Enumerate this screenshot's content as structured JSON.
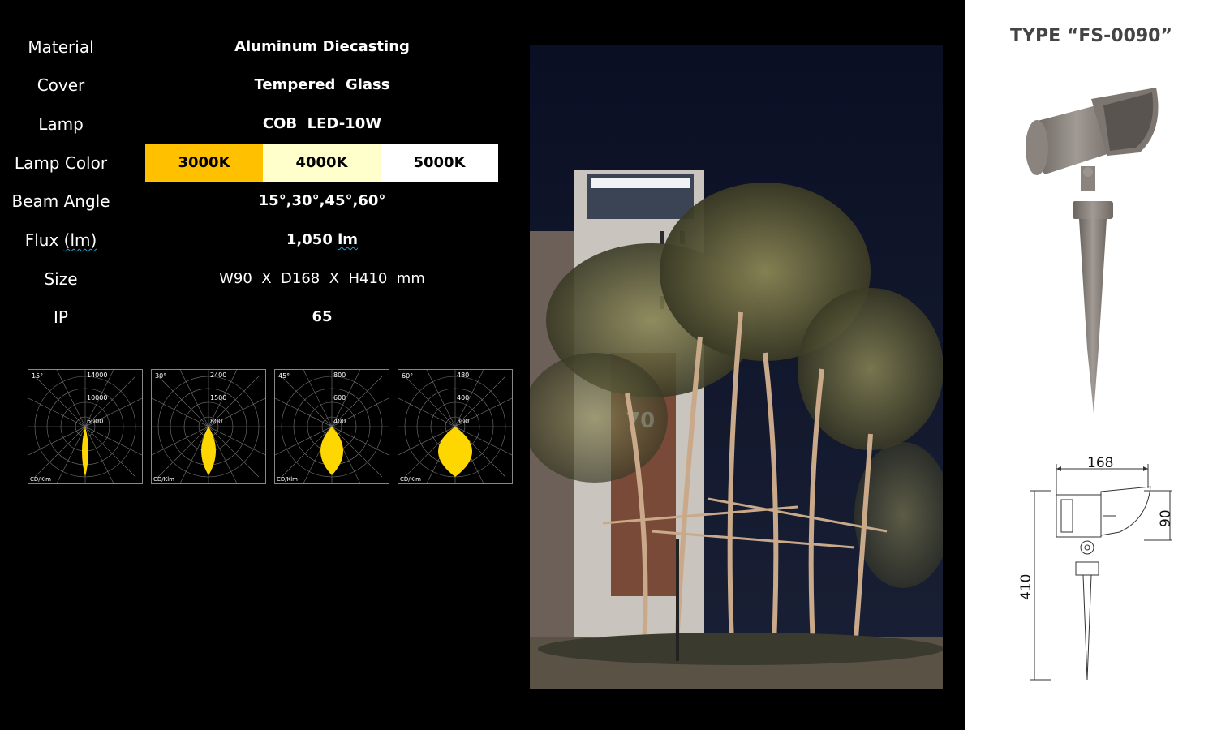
{
  "specs": [
    {
      "label": "Material",
      "value": "Aluminum Diecasting"
    },
    {
      "label": "Cover",
      "value": "Tempered  Glass"
    },
    {
      "label": "Lamp",
      "value": "COB  LED-10W"
    },
    {
      "label": "Lamp Color"
    },
    {
      "label": "Beam Angle",
      "value": "15°,30°,45°,60°"
    },
    {
      "label": "Flux",
      "label_unit": "(lm)",
      "value": "1,050",
      "value_unit": "lm"
    },
    {
      "label": "Size",
      "value": "W90  X  D168  X  H410  mm"
    },
    {
      "label": "IP",
      "value": "65"
    }
  ],
  "lamp_colors": [
    {
      "label": "3000K",
      "color": "#FFC000"
    },
    {
      "label": "4000K",
      "color": "#FFFFCC"
    },
    {
      "label": "5000K",
      "color": "#FFFFFF"
    }
  ],
  "polar_charts": [
    {
      "angle": "15°",
      "ticks": [
        "14000",
        "10000",
        "6000"
      ],
      "unit": "CD/Klm"
    },
    {
      "angle": "30°",
      "ticks": [
        "2400",
        "1500",
        "800"
      ],
      "unit": "CD/Klm"
    },
    {
      "angle": "45°",
      "ticks": [
        "800",
        "600",
        "400"
      ],
      "unit": "CD/Klm"
    },
    {
      "angle": "60°",
      "ticks": [
        "480",
        "400",
        "300"
      ],
      "unit": "CD/Klm"
    }
  ],
  "product": {
    "title": "TYPE “FS-0090”",
    "dim_width": "168",
    "dim_head": "90",
    "dim_height": "410"
  },
  "photo": {
    "building_number": "70"
  }
}
